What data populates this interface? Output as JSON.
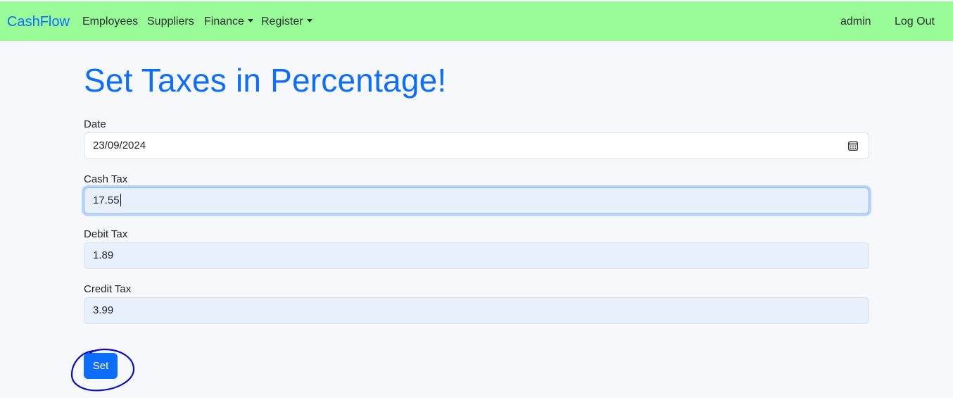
{
  "navbar": {
    "brand": "CashFlow",
    "items": [
      {
        "label": "Employees",
        "dropdown": false
      },
      {
        "label": "Suppliers",
        "dropdown": false
      },
      {
        "label": "Finance",
        "dropdown": true
      },
      {
        "label": "Register",
        "dropdown": true
      }
    ],
    "user": "admin",
    "logout": "Log Out",
    "background_color": "#98fb98",
    "brand_color": "#0d6efd"
  },
  "page": {
    "title": "Set Taxes in Percentage!"
  },
  "form": {
    "date": {
      "label": "Date",
      "value": "23/09/2024",
      "icon": "calendar-icon"
    },
    "cash_tax": {
      "label": "Cash Tax",
      "value": "17.55",
      "focused": true
    },
    "debit_tax": {
      "label": "Debit Tax",
      "value": "1.89"
    },
    "credit_tax": {
      "label": "Credit Tax",
      "value": "3.99"
    },
    "submit_label": "Set"
  }
}
